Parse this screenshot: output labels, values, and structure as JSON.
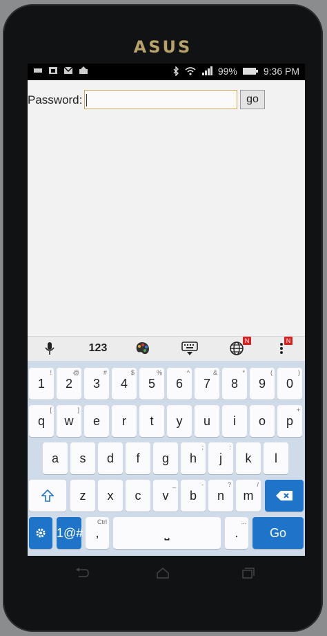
{
  "device": {
    "brand": "ASUS"
  },
  "status_bar": {
    "battery": "99%",
    "time": "9:36 PM",
    "left_icons": [
      "notification-icon",
      "photo-icon",
      "gmail-icon",
      "upload-icon"
    ],
    "right_icons": [
      "bluetooth-icon",
      "wifi-icon",
      "signal-icon",
      "battery-icon"
    ]
  },
  "form": {
    "password_label": "Password:",
    "password_value": "",
    "go_label": "go"
  },
  "keyboard_toolbar": {
    "mic": "mic-icon",
    "numbers_label": "123",
    "theme": "palette-icon",
    "hide": "keyboard-hide-icon",
    "language": "globe-icon",
    "language_badge": "N",
    "more": "more-vert-icon",
    "more_badge": "N"
  },
  "keyboard": {
    "row1": [
      {
        "label": "1",
        "hint": "!"
      },
      {
        "label": "2",
        "hint": "@"
      },
      {
        "label": "3",
        "hint": "#"
      },
      {
        "label": "4",
        "hint": "$"
      },
      {
        "label": "5",
        "hint": "%"
      },
      {
        "label": "6",
        "hint": "^"
      },
      {
        "label": "7",
        "hint": "&"
      },
      {
        "label": "8",
        "hint": "*"
      },
      {
        "label": "9",
        "hint": "("
      },
      {
        "label": "0",
        "hint": ")"
      }
    ],
    "row2": [
      {
        "label": "q",
        "hint": "["
      },
      {
        "label": "w",
        "hint": "]"
      },
      {
        "label": "e",
        "hint": ""
      },
      {
        "label": "r",
        "hint": ""
      },
      {
        "label": "t",
        "hint": ""
      },
      {
        "label": "y",
        "hint": ""
      },
      {
        "label": "u",
        "hint": ""
      },
      {
        "label": "i",
        "hint": ""
      },
      {
        "label": "o",
        "hint": ""
      },
      {
        "label": "p",
        "hint": "+"
      }
    ],
    "row3": [
      {
        "label": "a",
        "hint": ""
      },
      {
        "label": "s",
        "hint": ""
      },
      {
        "label": "d",
        "hint": ""
      },
      {
        "label": "f",
        "hint": ""
      },
      {
        "label": "g",
        "hint": ""
      },
      {
        "label": "h",
        "hint": ";"
      },
      {
        "label": "j",
        "hint": ":"
      },
      {
        "label": "k",
        "hint": ""
      },
      {
        "label": "l",
        "hint": ""
      }
    ],
    "row4": [
      {
        "label": "z",
        "hint": ""
      },
      {
        "label": "x",
        "hint": ""
      },
      {
        "label": "c",
        "hint": ""
      },
      {
        "label": "v",
        "hint": "_"
      },
      {
        "label": "b",
        "hint": "-"
      },
      {
        "label": "n",
        "hint": "?"
      },
      {
        "label": "m",
        "hint": "/"
      }
    ],
    "symbols_label": "1@#",
    "comma_label": ",",
    "comma_hint": "Ctrl",
    "period_label": ".",
    "period_hint": "...",
    "go_label": "Go",
    "space_label": "⎵"
  }
}
